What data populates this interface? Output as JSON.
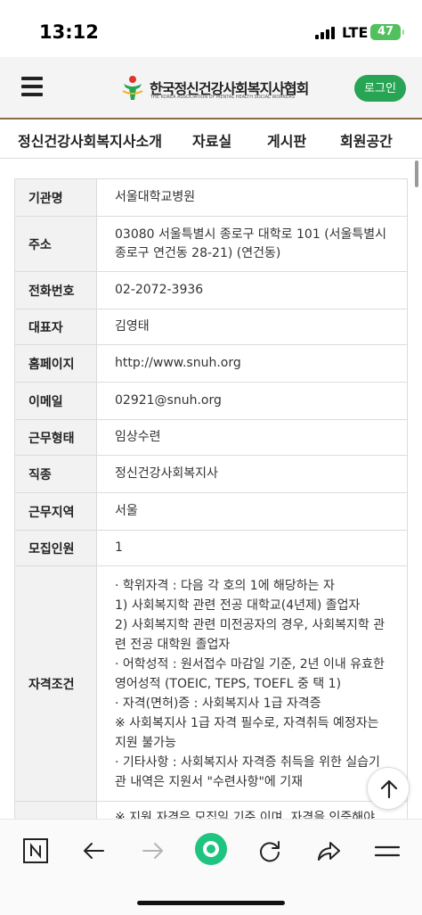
{
  "status_bar": {
    "time": "13:12",
    "network": "LTE",
    "battery": "47"
  },
  "header": {
    "logo_title": "한국정신건강사회복지사협회",
    "logo_subtitle": "THE KOREA ASSOCIATION OF MENTAL HEALTH SOCIAL WORKERS",
    "login_label": "로그인"
  },
  "nav": {
    "items": [
      "정신건강사회복지사소개",
      "자료실",
      "게시판",
      "회원공간"
    ]
  },
  "info": {
    "rows": [
      {
        "label": "기관명",
        "value": "서울대학교병원"
      },
      {
        "label": "주소",
        "value": "03080 서울특별시 종로구 대학로 101 (서울특별시 종로구 연건동 28-21) (연건동)"
      },
      {
        "label": "전화번호",
        "value": "02-2072-3936"
      },
      {
        "label": "대표자",
        "value": "김영태"
      },
      {
        "label": "홈페이지",
        "value": "http://www.snuh.org"
      },
      {
        "label": "이메일",
        "value": "02921@snuh.org"
      },
      {
        "label": "근무형태",
        "value": "임상수련"
      },
      {
        "label": "직종",
        "value": "정신건강사회복지사"
      },
      {
        "label": "근무지역",
        "value": "서울"
      },
      {
        "label": "모집인원",
        "value": "1"
      }
    ],
    "qualification": {
      "label": "자격조건",
      "lines": [
        "· 학위자격 : 다음 각 호의 1에 해당하는 자",
        "1) 사회복지학 관련 전공 대학교(4년제) 졸업자",
        "2) 사회복지학 관련 미전공자의 경우, 사회복지학 관련 전공 대학원 졸업자",
        "· 어학성적 : 원서접수 마감일 기준, 2년 이내 유효한 영어성적 (TOEIC, TEPS, TOEFL 중 택 1)",
        "·  자격(면허)증 : 사회복지사 1급 자격증",
        "※ 사회복지사 1급 자격 필수로, 자격취득 예정자는 지원 불가능",
        "·    기타사항 : 사회복지사 자격증 취득을 위한 실습기관 내역은 지원서 \"수련사항\"에 기재"
      ]
    },
    "next_row_partial": "※ 지원 자격은 모집일 기준 이며, 자격을 인증해야"
  },
  "icons": {
    "hamburger": "menu-icon",
    "top": "arrow-up-icon",
    "bottom": [
      "naver-n-icon",
      "back-arrow-icon",
      "forward-arrow-icon",
      "home-circle-icon",
      "refresh-icon",
      "share-icon",
      "menu-icon"
    ]
  },
  "colors": {
    "brand_green": "#27a454",
    "header_border": "#8a6d46"
  }
}
